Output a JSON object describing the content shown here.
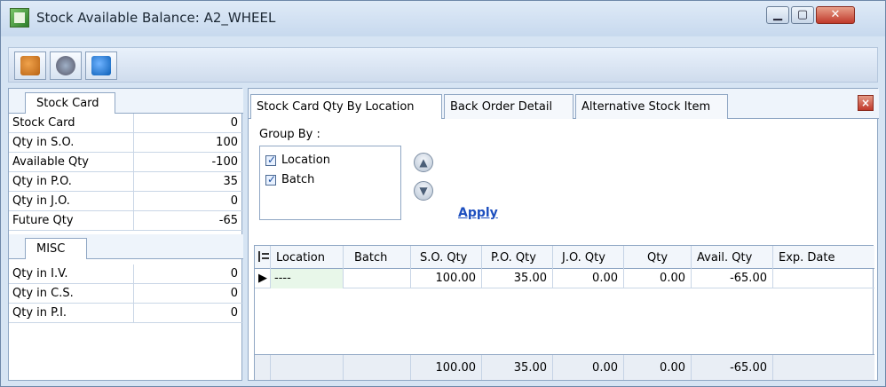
{
  "window": {
    "title": "Stock Available Balance: A2_WHEEL"
  },
  "left": {
    "tab1": "Stock Card",
    "stock_rows": [
      {
        "label": "Stock Card",
        "value": "0"
      },
      {
        "label": "Qty in S.O.",
        "value": "100"
      },
      {
        "label": "Available Qty",
        "value": "-100"
      },
      {
        "label": "Qty in P.O.",
        "value": "35"
      },
      {
        "label": "Qty in J.O.",
        "value": "0"
      },
      {
        "label": "Future Qty",
        "value": "-65"
      }
    ],
    "tab2": "MISC",
    "misc_rows": [
      {
        "label": "Qty in I.V.",
        "value": "0"
      },
      {
        "label": "Qty in C.S.",
        "value": "0"
      },
      {
        "label": "Qty in P.I.",
        "value": "0"
      }
    ]
  },
  "right": {
    "tabs": [
      "Stock Card Qty By Location",
      "Back Order Detail",
      "Alternative Stock Item"
    ],
    "group_by_label": "Group By :",
    "group_options": [
      {
        "label": "Location",
        "checked": true
      },
      {
        "label": "Batch",
        "checked": true
      }
    ],
    "apply_label": "Apply",
    "grid": {
      "headers": [
        "Location",
        "Batch",
        "S.O. Qty",
        "P.O. Qty",
        "J.O. Qty",
        "Qty",
        "Avail. Qty",
        "Exp. Date"
      ],
      "row": [
        "----",
        "",
        "100.00",
        "35.00",
        "0.00",
        "0.00",
        "-65.00",
        ""
      ],
      "footer": [
        "",
        "",
        "100.00",
        "35.00",
        "0.00",
        "0.00",
        "-65.00",
        ""
      ]
    }
  }
}
